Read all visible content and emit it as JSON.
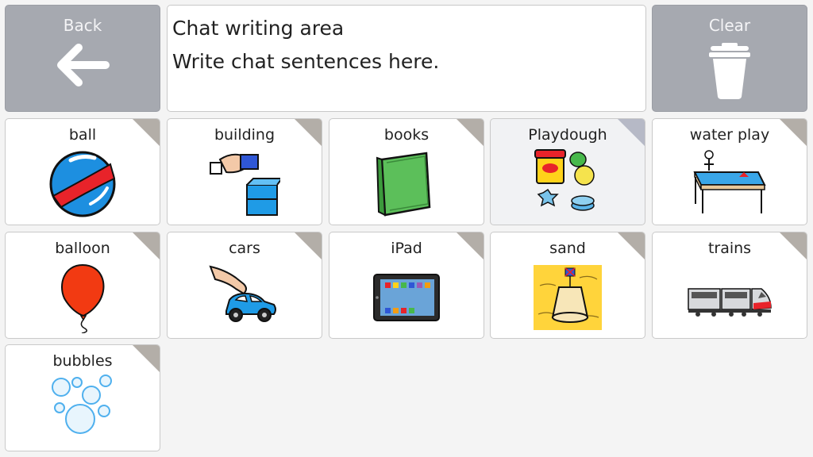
{
  "toolbar": {
    "back_label": "Back",
    "clear_label": "Clear"
  },
  "chat": {
    "title": "Chat writing area",
    "placeholder": "Write chat sentences here."
  },
  "tiles": [
    {
      "label": "ball",
      "icon": "ball-icon"
    },
    {
      "label": "building",
      "icon": "building-blocks-icon"
    },
    {
      "label": "books",
      "icon": "book-icon"
    },
    {
      "label": "Playdough",
      "icon": "playdough-icon"
    },
    {
      "label": "water play",
      "icon": "water-table-icon"
    },
    {
      "label": "balloon",
      "icon": "balloon-icon"
    },
    {
      "label": "cars",
      "icon": "toy-car-icon"
    },
    {
      "label": "iPad",
      "icon": "tablet-icon"
    },
    {
      "label": "sand",
      "icon": "sandcastle-icon"
    },
    {
      "label": "trains",
      "icon": "train-icon"
    },
    {
      "label": "bubbles",
      "icon": "bubbles-icon"
    }
  ]
}
